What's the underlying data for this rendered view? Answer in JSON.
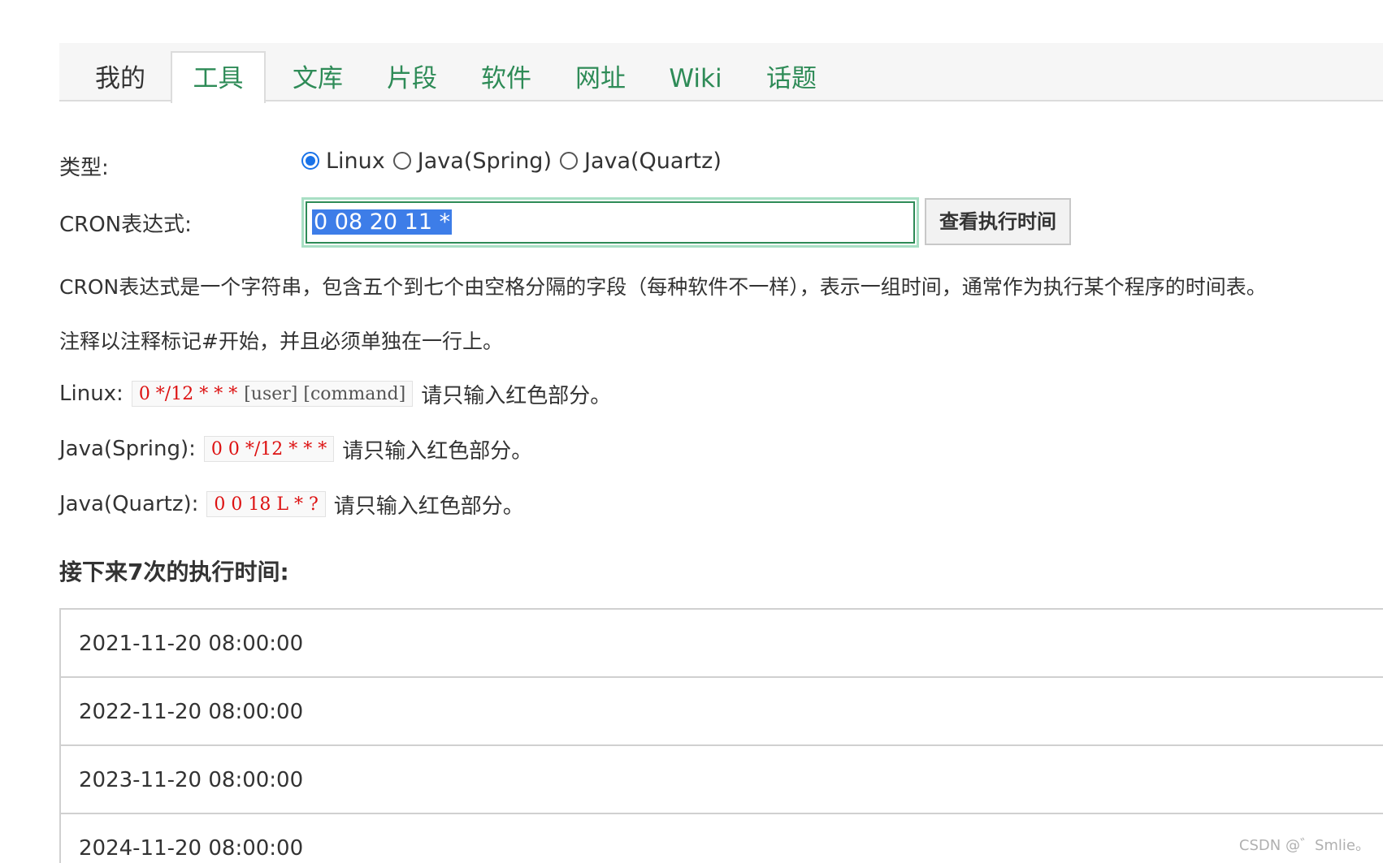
{
  "tabs": [
    {
      "label": "我的"
    },
    {
      "label": "工具"
    },
    {
      "label": "文库"
    },
    {
      "label": "片段"
    },
    {
      "label": "软件"
    },
    {
      "label": "网址"
    },
    {
      "label": "Wiki"
    },
    {
      "label": "话题"
    }
  ],
  "form": {
    "type_label": "类型:",
    "radio_options": [
      {
        "label": "Linux",
        "checked": true
      },
      {
        "label": "Java(Spring)",
        "checked": false
      },
      {
        "label": "Java(Quartz)",
        "checked": false
      }
    ],
    "cron_label": "CRON表达式:",
    "cron_value": "0 08 20 11 *",
    "submit_label": "查看执行时间"
  },
  "description": {
    "line1": "CRON表达式是一个字符串，包含五个到七个由空格分隔的字段（每种软件不一样），表示一组时间，通常作为执行某个程序的时间表。",
    "line2": "注释以注释标记#开始，并且必须单独在一行上。"
  },
  "examples": [
    {
      "prefix": "Linux:",
      "red": "0 */12 * * *",
      "gray": "[user] [command]",
      "suffix": "请只输入红色部分。"
    },
    {
      "prefix": "Java(Spring):",
      "red": "0 0 */12 * * *",
      "gray": "",
      "suffix": "请只输入红色部分。"
    },
    {
      "prefix": "Java(Quartz):",
      "red": "0 0 18 L * ?",
      "gray": "",
      "suffix": "请只输入红色部分。"
    }
  ],
  "results": {
    "heading": "接下来7次的执行时间:",
    "times": [
      "2021-11-20 08:00:00",
      "2022-11-20 08:00:00",
      "2023-11-20 08:00:00",
      "2024-11-20 08:00:00"
    ]
  },
  "watermark": "CSDN @゛Smlie。",
  "colors": {
    "accent_green": "#2e8b57",
    "radio_blue": "#1a73e8",
    "code_red": "#dd1111"
  }
}
